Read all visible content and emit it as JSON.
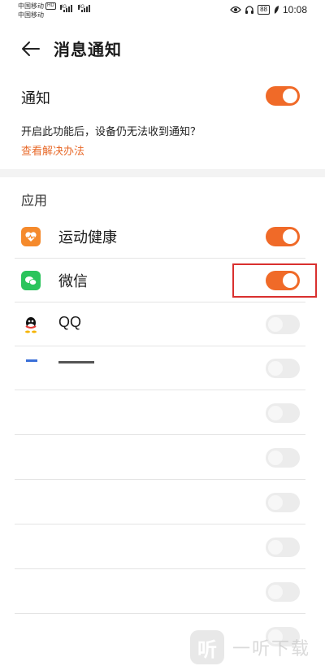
{
  "status_bar": {
    "carrier_1": "中国移动",
    "carrier_2": "中国移动",
    "hd_badge": "HD",
    "net_1": "4G",
    "net_2": "4G",
    "battery": "88",
    "time": "10:08",
    "icons": [
      "eye-icon",
      "headphone-icon",
      "battery-icon",
      "leaf-icon"
    ]
  },
  "header": {
    "back_icon": "arrow-left-icon",
    "title": "消息通知"
  },
  "notify": {
    "label": "通知",
    "enabled": true,
    "description": "开启此功能后，设备仍无法收到通知？",
    "help_link": "查看解决办法"
  },
  "apps_section": {
    "title": "应用",
    "items": [
      {
        "label": "运动健康",
        "icon": "health-app-icon",
        "icon_color": "#f58a2c",
        "enabled": true
      },
      {
        "label": "微信",
        "icon": "wechat-app-icon",
        "icon_color": "#2bc45c",
        "enabled": true,
        "highlighted": true
      },
      {
        "label": "QQ",
        "icon": "qq-app-icon",
        "icon_color": "#111111",
        "enabled": false
      },
      {
        "label": "",
        "icon": "",
        "icon_color": "#3a6fd8",
        "enabled": false
      }
    ],
    "empty_rows": 7
  },
  "watermark": {
    "logo_char": "听",
    "text": "一听下载"
  },
  "colors": {
    "accent": "#f06a28",
    "highlight_border": "#d9302f",
    "link": "#e86a2a"
  }
}
